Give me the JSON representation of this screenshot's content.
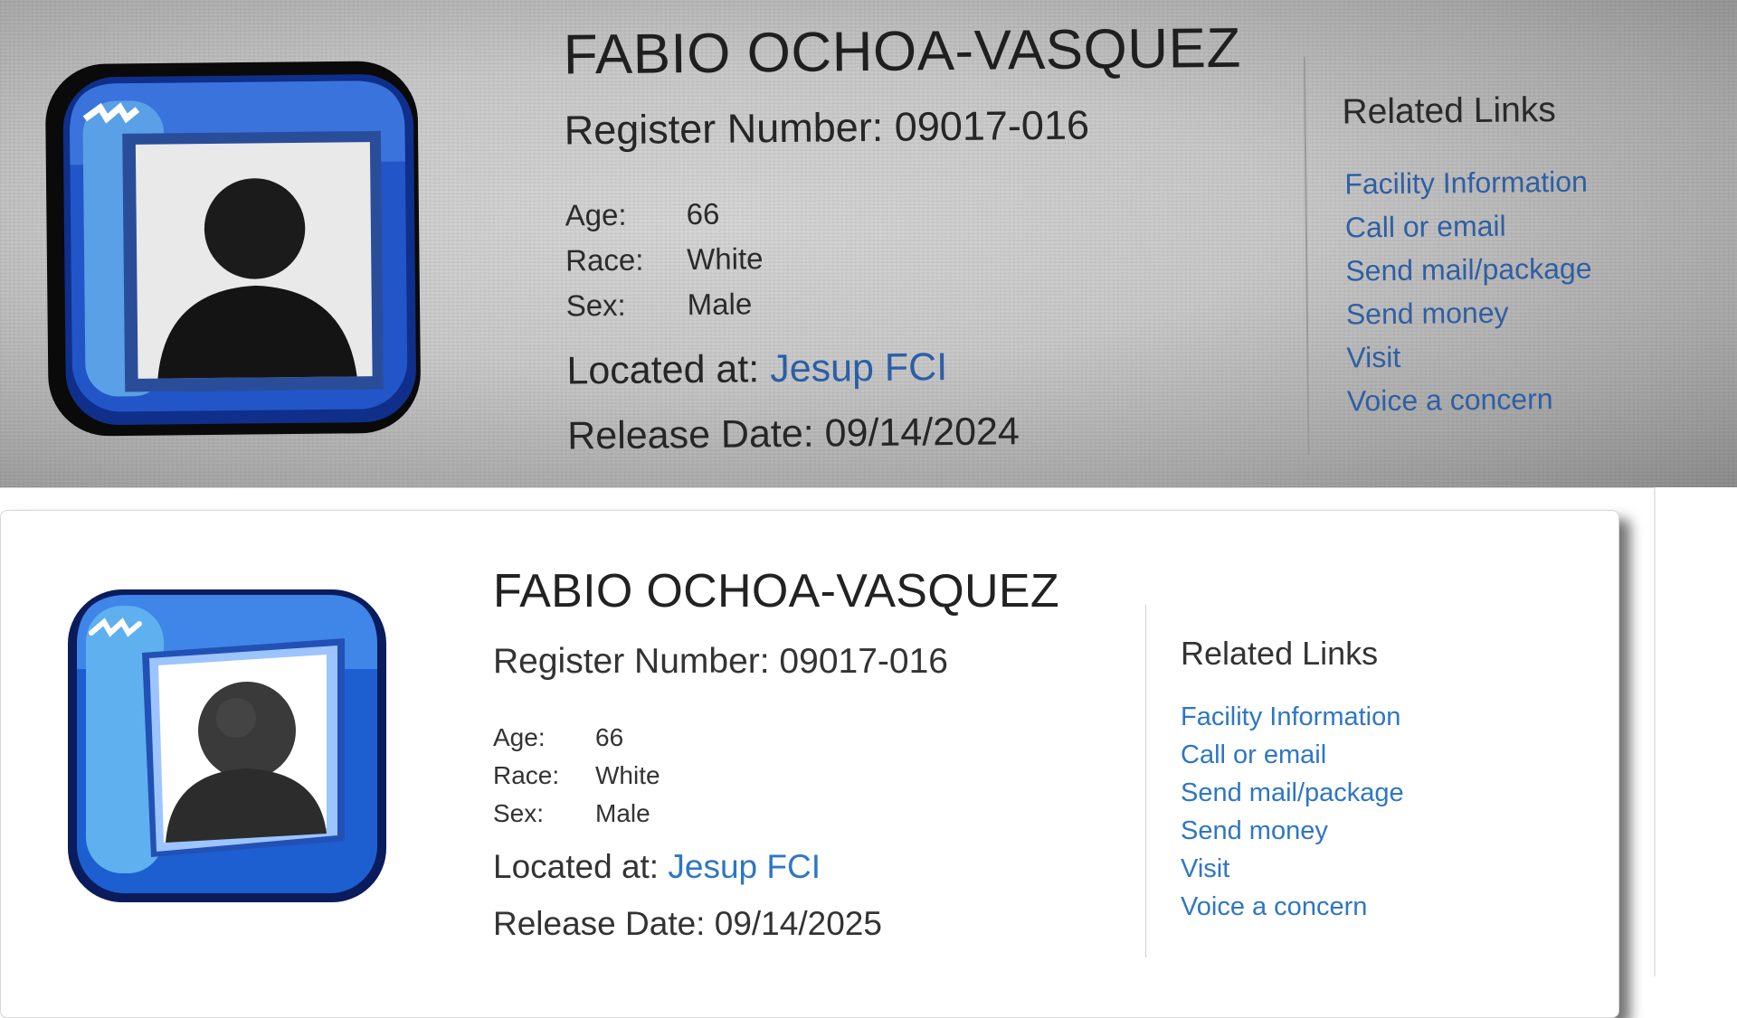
{
  "photo": {
    "name": "FABIO OCHOA-VASQUEZ",
    "register_label": "Register Number: 09017-016",
    "facts": [
      {
        "label": "Age:",
        "value": "66"
      },
      {
        "label": "Race:",
        "value": "White"
      },
      {
        "label": "Sex:",
        "value": "Male"
      }
    ],
    "located_label": "Located at:",
    "located_link": "Jesup FCI",
    "release": "Release Date: 09/14/2024",
    "related_title": "Related Links",
    "links": [
      "Facility Information",
      "Call or email",
      "Send mail/package",
      "Send money",
      "Visit",
      "Voice a concern"
    ]
  },
  "record": {
    "name": "FABIO OCHOA-VASQUEZ",
    "register_label": "Register Number: 09017-016",
    "facts": [
      {
        "label": "Age:",
        "value": "66"
      },
      {
        "label": "Race:",
        "value": "White"
      },
      {
        "label": "Sex:",
        "value": "Male"
      }
    ],
    "located_label": "Located at:",
    "located_link": "Jesup FCI",
    "release": "Release Date: 09/14/2025",
    "related_title": "Related Links",
    "links": [
      "Facility Information",
      "Call or email",
      "Send mail/package",
      "Send money",
      "Visit",
      "Voice a concern"
    ]
  },
  "colors": {
    "link": "#2e76c4",
    "avatar_blue": "#1d5fd0",
    "avatar_dark": "#0b1c5c"
  },
  "icons": [
    "inmate-photo-placeholder-icon"
  ]
}
